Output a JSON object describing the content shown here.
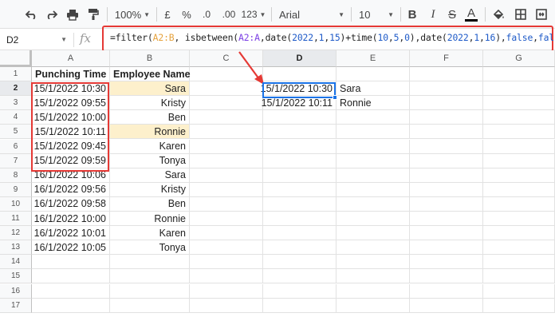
{
  "toolbar": {
    "zoom": "100%",
    "currency": "£",
    "percent": "%",
    "decrease_decimal": ".0",
    "increase_decimal": ".00",
    "more_formats": "123",
    "font": "Arial",
    "font_size": "10",
    "bold": "B",
    "italic": "I",
    "strike": "S",
    "text_color": "A"
  },
  "formula_bar": {
    "name_box": "D2",
    "fx": "fx",
    "formula_parts": [
      {
        "t": "=filter(",
        "c": ""
      },
      {
        "t": "A2:B",
        "c": "tk-range1"
      },
      {
        "t": ", isbetween(",
        "c": ""
      },
      {
        "t": "A2:A",
        "c": "tk-range2"
      },
      {
        "t": ",date(",
        "c": ""
      },
      {
        "t": "2022",
        "c": "tk-num"
      },
      {
        "t": ",",
        "c": ""
      },
      {
        "t": "1",
        "c": "tk-num"
      },
      {
        "t": ",",
        "c": ""
      },
      {
        "t": "15",
        "c": "tk-num"
      },
      {
        "t": ")+time(",
        "c": ""
      },
      {
        "t": "10",
        "c": "tk-num"
      },
      {
        "t": ",",
        "c": ""
      },
      {
        "t": "5",
        "c": "tk-num"
      },
      {
        "t": ",",
        "c": ""
      },
      {
        "t": "0",
        "c": "tk-num"
      },
      {
        "t": "),date(",
        "c": ""
      },
      {
        "t": "2022",
        "c": "tk-num"
      },
      {
        "t": ",",
        "c": ""
      },
      {
        "t": "1",
        "c": "tk-num"
      },
      {
        "t": ",",
        "c": ""
      },
      {
        "t": "16",
        "c": "tk-num"
      },
      {
        "t": "),",
        "c": ""
      },
      {
        "t": "false",
        "c": "tk-bool"
      },
      {
        "t": ",",
        "c": ""
      },
      {
        "t": "false",
        "c": "tk-bool"
      },
      {
        "t": "))",
        "c": ""
      }
    ]
  },
  "columns": [
    "A",
    "B",
    "C",
    "D",
    "E",
    "F",
    "G"
  ],
  "selected_column": "D",
  "rows": [
    1,
    2,
    3,
    4,
    5,
    6,
    7,
    8,
    9,
    10,
    11,
    12,
    13,
    14,
    15,
    16,
    17
  ],
  "selected_row": 2,
  "headers": {
    "a": "Punching Time",
    "b": "Employee Name"
  },
  "data": [
    {
      "time": "15/1/2022 10:30",
      "name": "Sara",
      "hl": true
    },
    {
      "time": "15/1/2022 09:55",
      "name": "Kristy",
      "hl": false
    },
    {
      "time": "15/1/2022 10:00",
      "name": "Ben",
      "hl": false
    },
    {
      "time": "15/1/2022 10:11",
      "name": "Ronnie",
      "hl": true
    },
    {
      "time": "15/1/2022 09:45",
      "name": "Karen",
      "hl": false
    },
    {
      "time": "15/1/2022 09:59",
      "name": "Tonya",
      "hl": false
    },
    {
      "time": "16/1/2022 10:06",
      "name": "Sara",
      "hl": false
    },
    {
      "time": "16/1/2022 09:56",
      "name": "Kristy",
      "hl": false
    },
    {
      "time": "16/1/2022 09:58",
      "name": "Ben",
      "hl": false
    },
    {
      "time": "16/1/2022 10:00",
      "name": "Ronnie",
      "hl": false
    },
    {
      "time": "16/1/2022 10:01",
      "name": "Karen",
      "hl": false
    },
    {
      "time": "16/1/2022 10:05",
      "name": "Tonya",
      "hl": false
    }
  ],
  "results": [
    {
      "time": "15/1/2022 10:30",
      "name": "Sara"
    },
    {
      "time": "15/1/2022 10:11",
      "name": "Ronnie"
    }
  ],
  "colors": {
    "highlight": "#fdf0cc",
    "annotation": "#e53935",
    "selection": "#1a73e8"
  }
}
